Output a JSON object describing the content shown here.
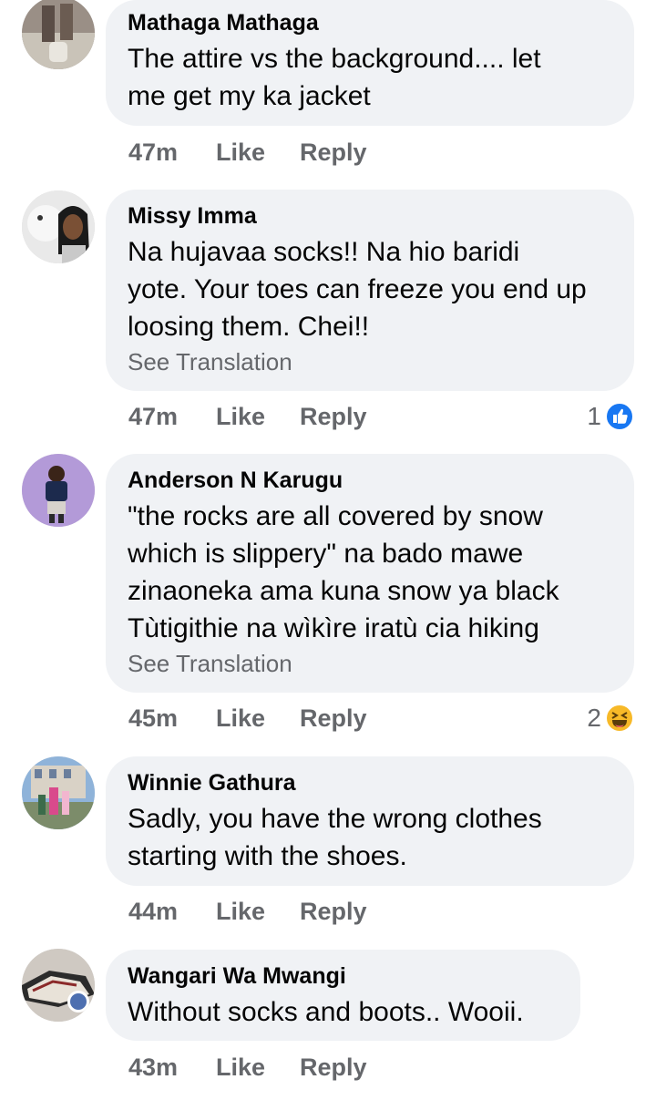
{
  "comments": [
    {
      "author": "Mathaga Mathaga",
      "text": "The attire vs the background.... let\nme get my ka jacket",
      "time": "47m",
      "like": "Like",
      "reply": "Reply"
    },
    {
      "author": "Missy Imma",
      "text": "Na hujavaa socks!!  Na hio baridi\nyote. Your toes can freeze you end up\nloosing them. Chei!!",
      "see_translation": "See Translation",
      "time": "47m",
      "like": "Like",
      "reply": "Reply",
      "reaction": {
        "count": "1",
        "icon": "like-reaction-icon",
        "color": "#1877f2"
      }
    },
    {
      "author": "Anderson N Karugu",
      "text": "\"the rocks are all covered by snow\nwhich is slippery\" na bado mawe\nzinaoneka ama kuna snow ya black\nTùtigithie na wìkìre iratù cia hiking",
      "see_translation": "See Translation",
      "time": "45m",
      "like": "Like",
      "reply": "Reply",
      "reaction": {
        "count": "2",
        "icon": "haha-reaction-icon",
        "color": "#f7b928"
      }
    },
    {
      "author": "Winnie Gathura",
      "text": "Sadly, you have the wrong clothes\nstarting with the shoes.",
      "time": "44m",
      "like": "Like",
      "reply": "Reply"
    },
    {
      "author": "Wangari Wa Mwangi",
      "text": "Without socks and boots.. Wooii.",
      "time": "43m",
      "like": "Like",
      "reply": "Reply"
    }
  ],
  "colors": {
    "bubble": "#f0f2f5",
    "meta": "#65676b",
    "text": "#050505"
  }
}
